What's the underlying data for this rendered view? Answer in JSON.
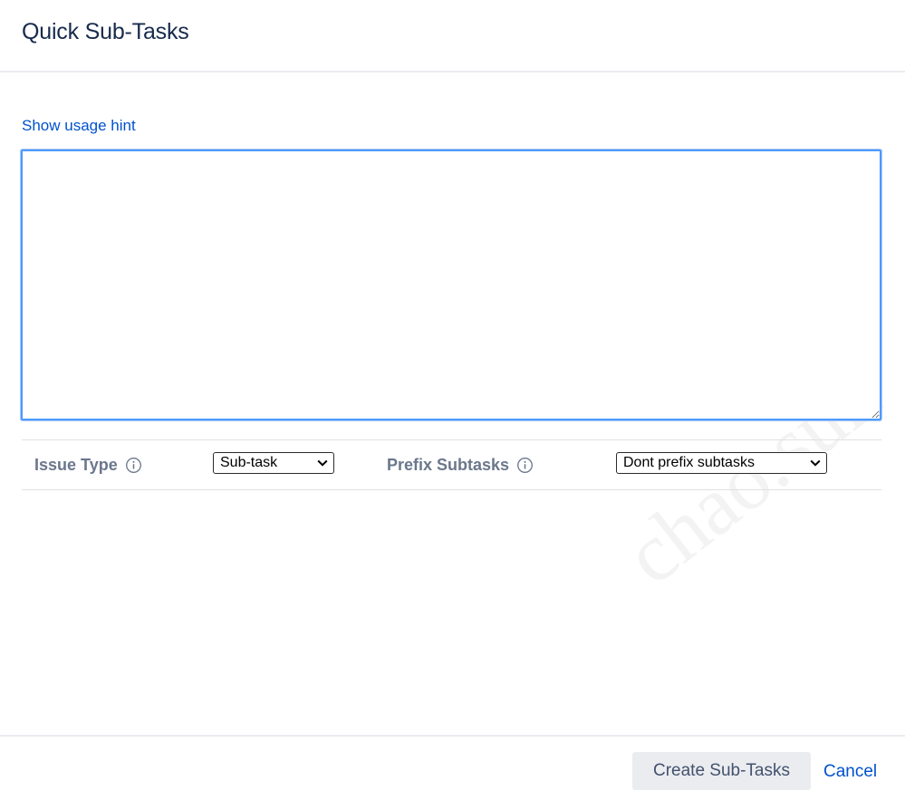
{
  "dialog": {
    "title": "Quick Sub-Tasks"
  },
  "usage_hint": {
    "label": "Show usage hint"
  },
  "task_input": {
    "value": "",
    "placeholder": ""
  },
  "options": {
    "issue_type": {
      "label": "Issue Type",
      "selected": "Sub-task",
      "icon": "info-icon"
    },
    "prefix_subtasks": {
      "label": "Prefix Subtasks",
      "selected": "Dont prefix subtasks",
      "icon": "info-icon"
    }
  },
  "footer": {
    "create_label": "Create Sub-Tasks",
    "cancel_label": "Cancel"
  },
  "watermark": {
    "text": "chao.sun"
  },
  "colors": {
    "link": "#0052cc",
    "focus_border": "#4c9aff",
    "label_gray": "#6b778c",
    "button_bg": "#ebecf0",
    "title": "#172b4d"
  }
}
